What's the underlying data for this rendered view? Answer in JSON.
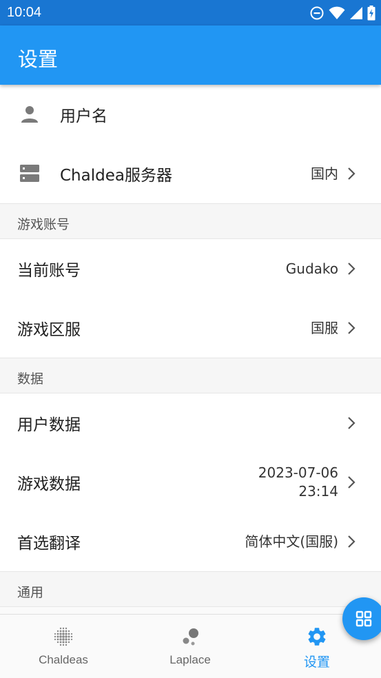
{
  "status_bar": {
    "time": "10:04"
  },
  "app_bar": {
    "title": "设置"
  },
  "top_items": [
    {
      "label": "用户名",
      "value": "",
      "icon": "person-icon"
    },
    {
      "label": "Chaldea服务器",
      "value": "国内",
      "icon": "server-icon"
    }
  ],
  "sections": [
    {
      "header": "游戏账号",
      "items": [
        {
          "label": "当前账号",
          "value": "Gudako"
        },
        {
          "label": "游戏区服",
          "value": "国服"
        }
      ]
    },
    {
      "header": "数据",
      "items": [
        {
          "label": "用户数据",
          "value": ""
        },
        {
          "label": "游戏数据",
          "value_line1": "2023-07-06",
          "value_line2": "23:14"
        },
        {
          "label": "首选翻译",
          "value": "简体中文(国服)"
        }
      ]
    },
    {
      "header": "通用",
      "items": []
    }
  ],
  "bottom_nav": [
    {
      "label": "Chaldeas",
      "icon": "dots-grid-icon",
      "active": false
    },
    {
      "label": "Laplace",
      "icon": "bubbles-icon",
      "active": false
    },
    {
      "label": "设置",
      "icon": "gear-icon",
      "active": true
    }
  ],
  "colors": {
    "primary": "#2196f3",
    "status_bar": "#1976d2"
  }
}
